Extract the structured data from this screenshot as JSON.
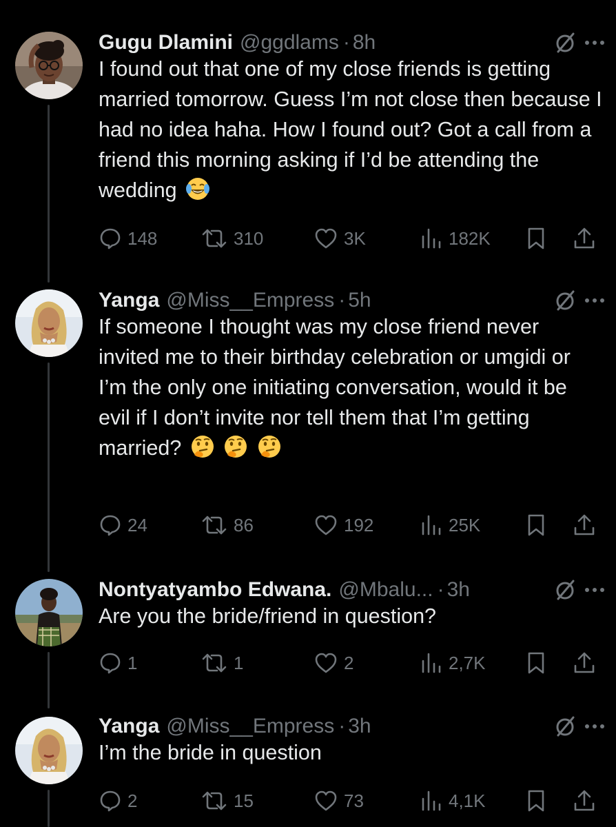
{
  "tweets": [
    {
      "name": "Gugu Dlamini",
      "handle": "@ggdlams",
      "separator": "·",
      "time": "8h",
      "text": "I found out that one of my close friends is getting married tomorrow. Guess I’m not close then because I had no idea haha. How I found out? Got a call from a friend this morning asking if I’d be attending the wedding",
      "emojis": [
        "face-with-tears-of-joy"
      ],
      "replies": "148",
      "reposts": "310",
      "likes": "3K",
      "views": "182K"
    },
    {
      "name": "Yanga",
      "handle": "@Miss__Empress",
      "separator": "·",
      "time": "5h",
      "text": "If someone I thought was my close friend never invited me to their birthday celebration or umgidi or I’m the only one initiating conversation, would it be evil if I don’t invite nor tell them that I’m getting married?",
      "emojis": [
        "thinking-face",
        "thinking-face",
        "thinking-face"
      ],
      "replies": "24",
      "reposts": "86",
      "likes": "192",
      "views": "25K"
    },
    {
      "name": "Nontyatyambo Edwana.",
      "handle": "@Mbalu...",
      "separator": "·",
      "time": "3h",
      "text": "Are you the bride/friend in question?",
      "emojis": [],
      "replies": "1",
      "reposts": "1",
      "likes": "2",
      "views": "2,7K"
    },
    {
      "name": "Yanga",
      "handle": "@Miss__Empress",
      "separator": "·",
      "time": "3h",
      "text": "I’m the bride in question",
      "emojis": [],
      "replies": "2",
      "reposts": "15",
      "likes": "73",
      "views": "4,1K"
    }
  ],
  "colors": {
    "background": "#000000",
    "text": "#e7e9ea",
    "muted": "#71767b",
    "thread_line": "#333639"
  }
}
